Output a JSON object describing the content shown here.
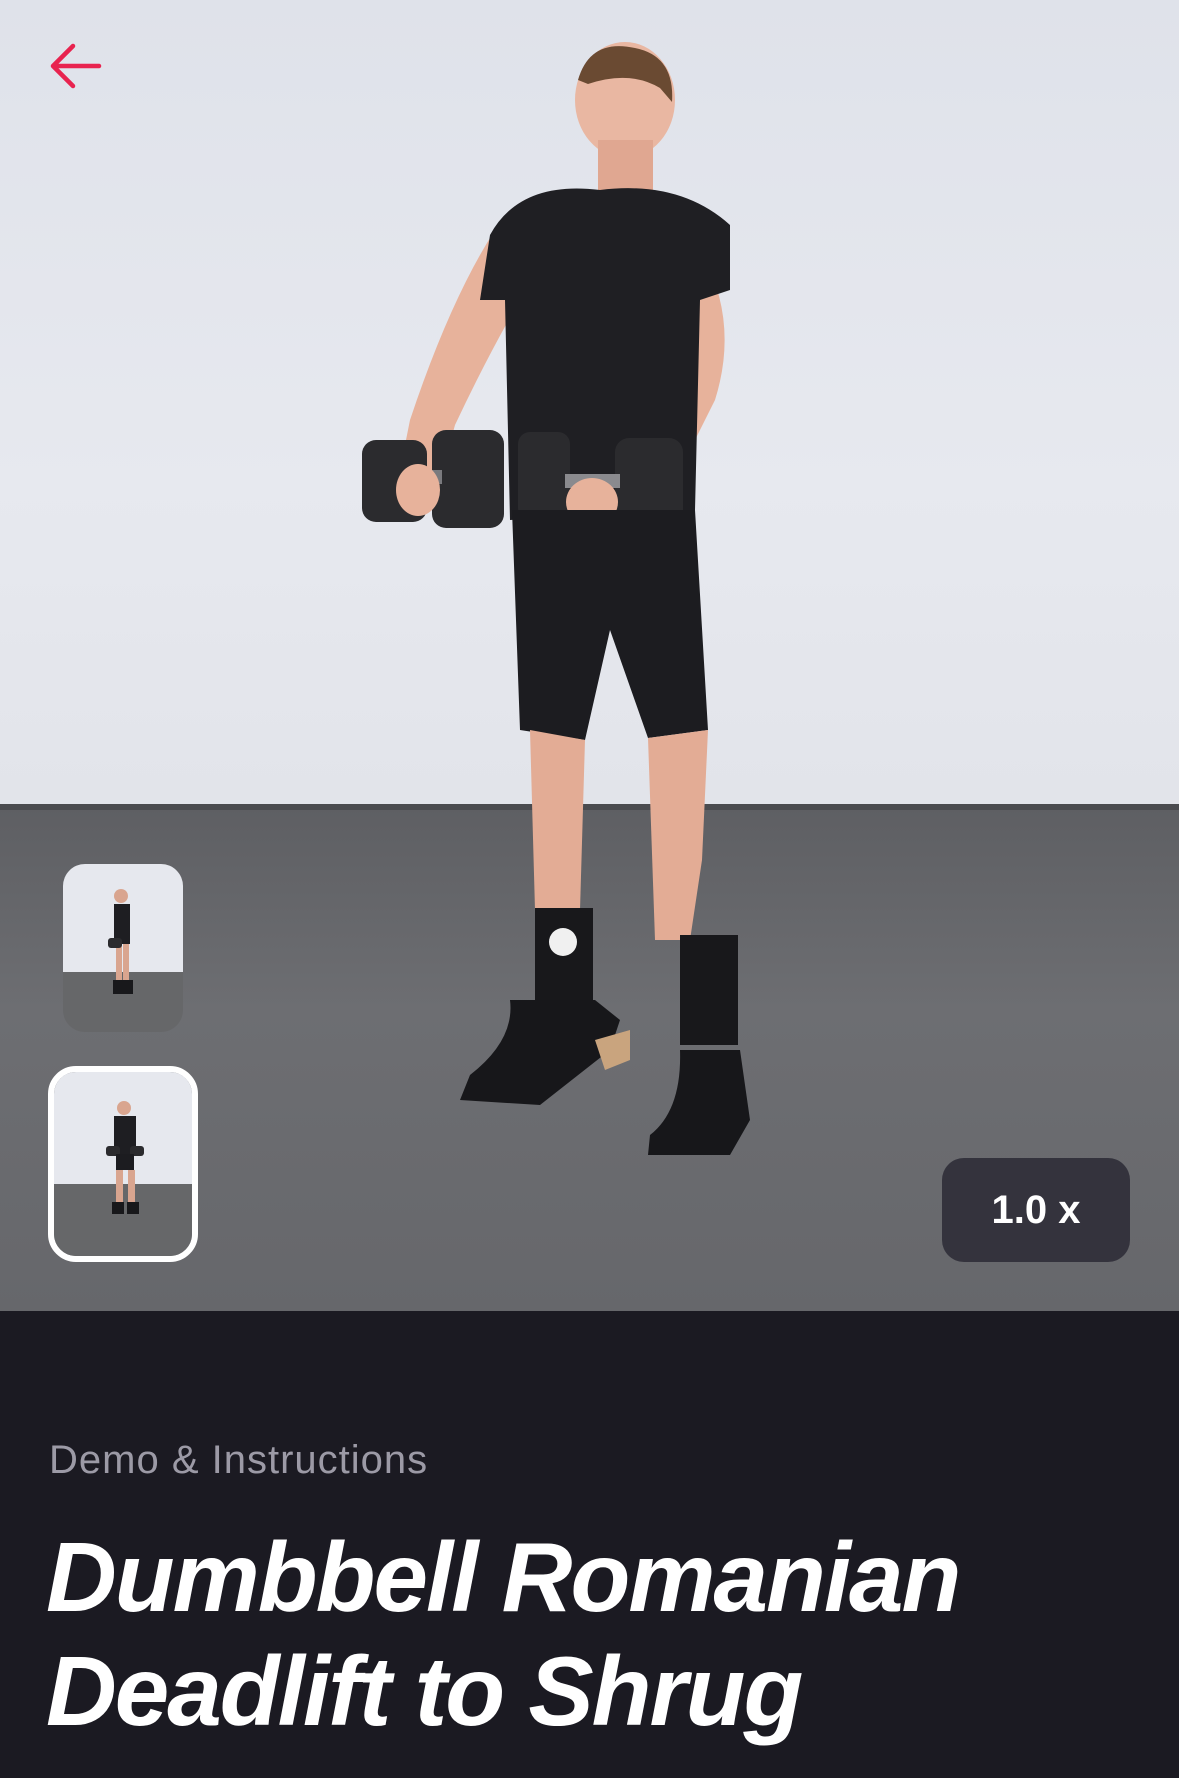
{
  "header": {
    "back_icon": "arrow-left-icon",
    "accent_color": "#e8234f"
  },
  "video": {
    "speed_label": "1.0 x",
    "thumbnails": [
      {
        "name": "side-view-thumbnail",
        "selected": false
      },
      {
        "name": "front-view-thumbnail",
        "selected": true
      }
    ]
  },
  "content": {
    "subtitle": "Demo & Instructions",
    "title": "Dumbbell Romanian Deadlift to Shrug"
  }
}
